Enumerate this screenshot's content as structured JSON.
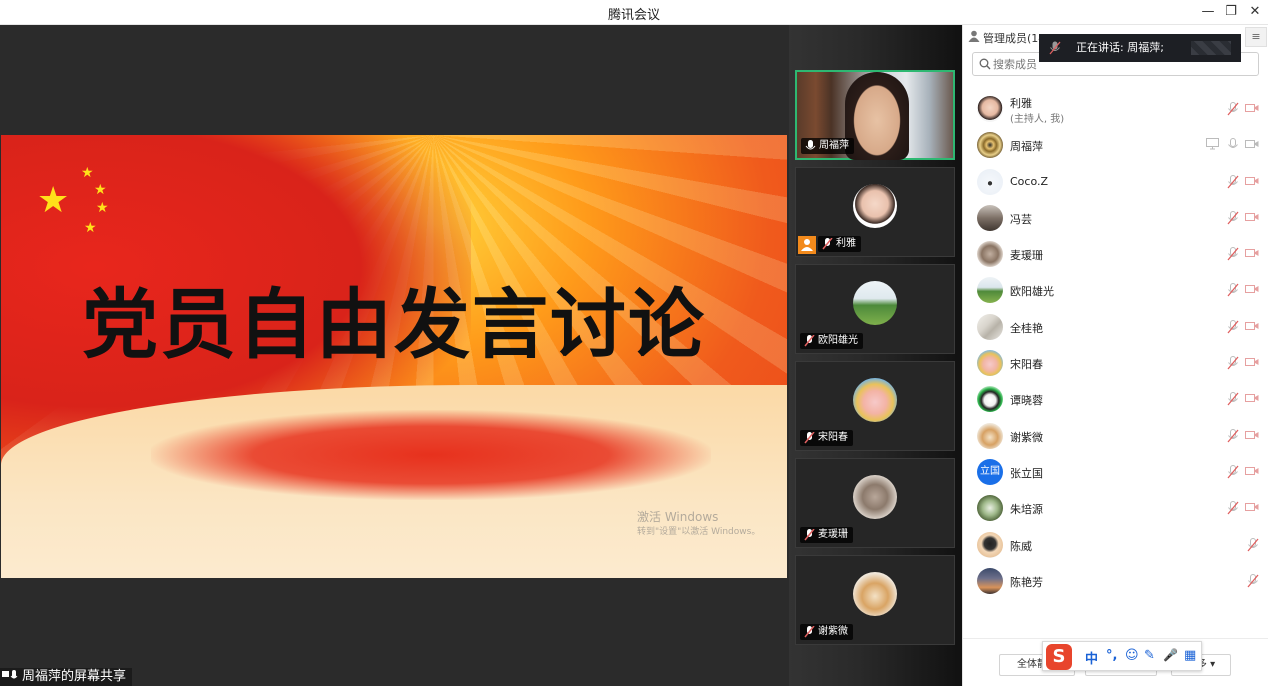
{
  "window": {
    "title": "腾讯会议",
    "min": "—",
    "restore": "❐",
    "close": "✕"
  },
  "share": {
    "slide_title": "党员自由发言讨论",
    "watermark_line1": "激活 Windows",
    "watermark_line2": "转到\"设置\"以激活 Windows。",
    "label": "周福萍的屏幕共享"
  },
  "videos": [
    {
      "name": "周福萍",
      "active": true,
      "mic": "on"
    },
    {
      "name": "利雅",
      "host": true,
      "mic": "off"
    },
    {
      "name": "欧阳雄光",
      "mic": "off"
    },
    {
      "name": "宋阳春",
      "mic": "off"
    },
    {
      "name": "麦瑗珊",
      "mic": "off"
    },
    {
      "name": "谢紫微",
      "mic": "off"
    }
  ],
  "panel": {
    "header": "管理成员(14)",
    "menu_icon": "≡",
    "speaking": "正在讲话: 周福萍;",
    "search_placeholder": "搜索成员",
    "members": [
      {
        "name": "利雅",
        "sub": "(主持人, 我)",
        "mic": "off",
        "cam": true
      },
      {
        "name": "周福萍",
        "mic": "on",
        "cam": true,
        "sharing": true
      },
      {
        "name": "Coco.Z",
        "mic": "off",
        "cam": true
      },
      {
        "name": "冯芸",
        "mic": "off",
        "cam": true
      },
      {
        "name": "麦瑗珊",
        "mic": "off",
        "cam": true
      },
      {
        "name": "欧阳雄光",
        "mic": "off",
        "cam": true
      },
      {
        "name": "全桂艳",
        "mic": "off",
        "cam": true
      },
      {
        "name": "宋阳春",
        "mic": "off",
        "cam": true
      },
      {
        "name": "谭晓蓉",
        "mic": "off",
        "cam": true
      },
      {
        "name": "谢紫微",
        "mic": "off",
        "cam": true
      },
      {
        "name": "张立国",
        "mic": "off",
        "cam": true,
        "initials": "立国"
      },
      {
        "name": "朱培源",
        "mic": "off",
        "cam": true
      },
      {
        "name": "陈威",
        "mic": "off",
        "cam": false
      },
      {
        "name": "陈艳芳",
        "mic": "off",
        "cam": false
      }
    ],
    "footer": {
      "mute_all": "全体静音",
      "unmute_all": "解除全体静音",
      "more": "更多 ▾"
    }
  },
  "ime": {
    "logo": "S",
    "items": [
      "中",
      "°,",
      "☺",
      "✎",
      "🎤",
      "▦"
    ]
  },
  "colors": {
    "active_border": "#2eb872",
    "mute_red": "#e06060",
    "host_orange": "#f28a1c",
    "ime_blue": "#1a62d6"
  }
}
